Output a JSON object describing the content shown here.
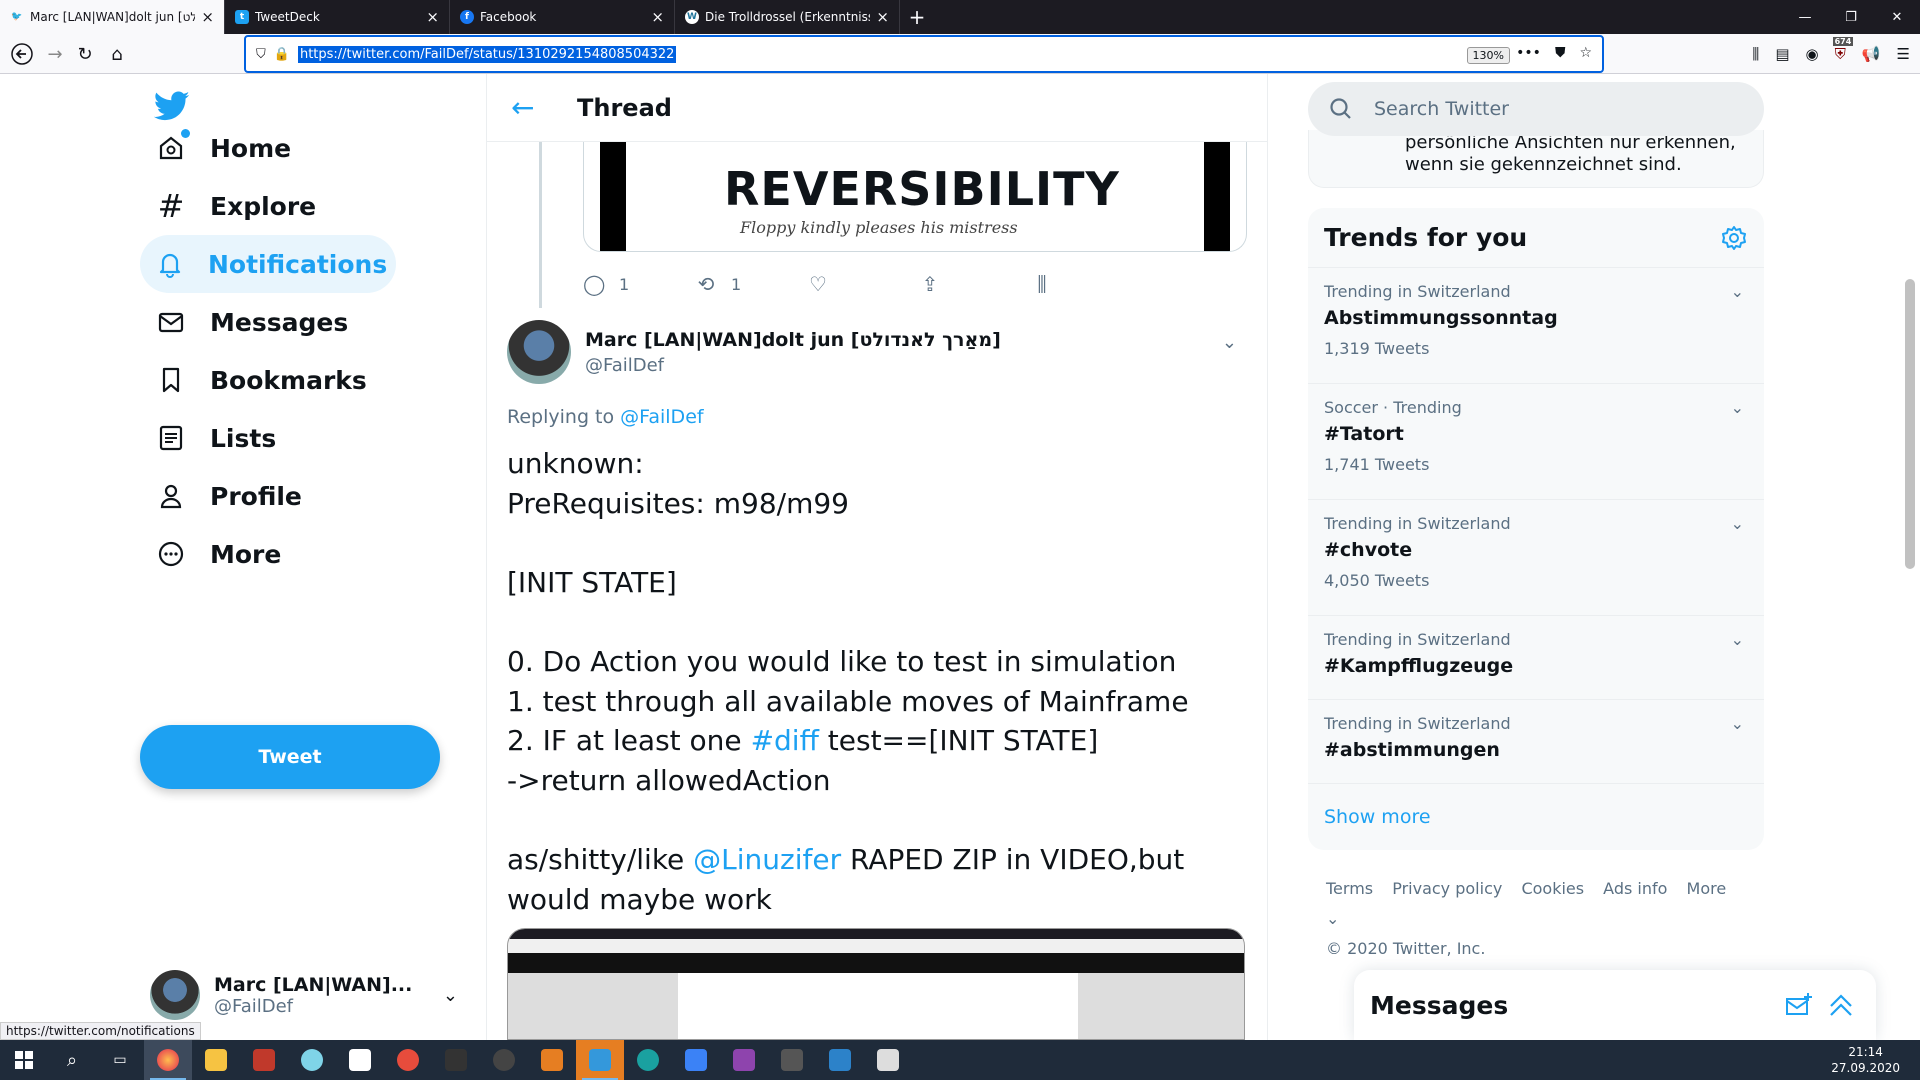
{
  "browser": {
    "tabs": [
      {
        "title": "Marc [LAN|WAN]dolt jun [מאַרך לאנדולט",
        "icon": "twitter-icon",
        "active": true
      },
      {
        "title": "TweetDeck",
        "icon": "twitter-icon",
        "active": false
      },
      {
        "title": "Facebook",
        "icon": "facebook-icon",
        "active": false
      },
      {
        "title": "Die Trolldrossel (Erkenntnisse d",
        "icon": "wordpress-icon",
        "active": false
      }
    ],
    "url": "https://twitter.com/FailDef/status/1310292154808504322",
    "zoom": "130%",
    "addon_badge": "674",
    "status_url": "https://twitter.com/notifications"
  },
  "sidebar": {
    "nav": [
      {
        "label": "Home",
        "icon": "home-icon"
      },
      {
        "label": "Explore",
        "icon": "hashtag-icon"
      },
      {
        "label": "Notifications",
        "icon": "bell-icon",
        "selected": true
      },
      {
        "label": "Messages",
        "icon": "envelope-icon"
      },
      {
        "label": "Bookmarks",
        "icon": "bookmark-icon"
      },
      {
        "label": "Lists",
        "icon": "list-icon"
      },
      {
        "label": "Profile",
        "icon": "person-icon"
      },
      {
        "label": "More",
        "icon": "more-circle-icon"
      }
    ],
    "tweet_button": "Tweet",
    "account": {
      "name": "Marc [LAN|WAN]...",
      "handle": "@FailDef"
    }
  },
  "thread": {
    "title": "Thread",
    "previous_tweet": {
      "image_title": "REVERSIBILITY",
      "image_handwriting": "Floppy kindly pleases his mistress",
      "replies": "1",
      "retweets": "1"
    },
    "tweet": {
      "author_name": "Marc [LAN|WAN]dolt jun [מאַרך לאנדולט]",
      "handle": "@FailDef",
      "replying_prefix": "Replying to",
      "replying_to": "@FailDef",
      "text_parts": [
        "unknown:\nPreRequisites: m98/m99\n\n[INIT STATE]\n\n0. Do Action you would like to test in simulation\n1. test through all available moves of Mainframe\n2. IF at least one ",
        "#diff",
        " test==[INIT STATE]\n->return allowedAction\n\nas/shitty/like ",
        "@Linuzifer",
        " RAPED ZIP in VIDEO,but would maybe work"
      ]
    }
  },
  "right": {
    "search_placeholder": "Search Twitter",
    "cut_text": "persönliche Ansichten nur erkennen,\nwenn sie gekennzeichnet sind.",
    "trends_title": "Trends for you",
    "trends": [
      {
        "context": "Trending in Switzerland",
        "name": "Abstimmungssonntag",
        "count": "1,319 Tweets"
      },
      {
        "context": "Soccer · Trending",
        "name": "#Tatort",
        "count": "1,741 Tweets"
      },
      {
        "context": "Trending in Switzerland",
        "name": "#chvote",
        "count": "4,050 Tweets"
      },
      {
        "context": "Trending in Switzerland",
        "name": "#Kampfflugzeuge",
        "count": ""
      },
      {
        "context": "Trending in Switzerland",
        "name": "#abstimmungen",
        "count": ""
      }
    ],
    "show_more": "Show more",
    "footer_links": [
      "Terms",
      "Privacy policy",
      "Cookies",
      "Ads info",
      "More"
    ],
    "copyright": "© 2020 Twitter, Inc.",
    "messages_title": "Messages"
  },
  "taskbar": {
    "time": "21:14",
    "date": "27.09.2020"
  },
  "colors": {
    "twitter_blue": "#1da1f2",
    "text": "#0f1419",
    "muted": "#5b7083"
  }
}
